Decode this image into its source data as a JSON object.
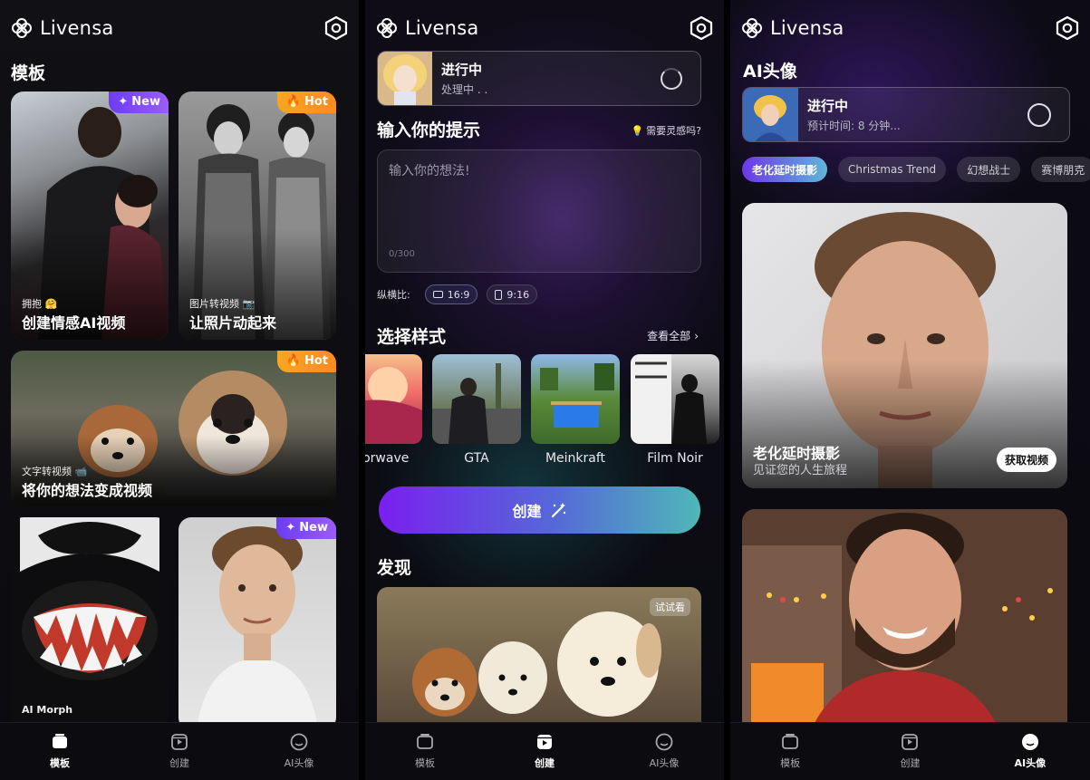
{
  "app": {
    "name": "Livensa"
  },
  "nav": {
    "templates": "模板",
    "create": "创建",
    "avatar": "AI头像"
  },
  "screen1": {
    "section_title": "模板",
    "cards": [
      {
        "badge": "New",
        "small": "拥抱 🤗",
        "title": "创建情感AI视频"
      },
      {
        "badge": "Hot",
        "small": "图片转视频 📷",
        "title": "让照片动起来"
      },
      {
        "badge": "Hot",
        "small": "文字转视频 📹",
        "title": "将你的想法变成视频"
      },
      {
        "badge": "",
        "small": "AI Morph",
        "title": ""
      },
      {
        "badge": "New",
        "small": "",
        "title": ""
      }
    ]
  },
  "screen2": {
    "progress": {
      "title": "进行中",
      "subtitle": "处理中 . ."
    },
    "prompt_title": "输入你的提示",
    "inspire": "需要灵感吗?",
    "prompt_placeholder": "输入你的想法!",
    "char_count": "0/300",
    "ratio_label": "纵横比:",
    "ratios": [
      "16:9",
      "9:16"
    ],
    "style_title": "选择样式",
    "view_all": "查看全部",
    "styles": [
      "aporwave",
      "GTA",
      "Meinkraft",
      "Film Noir"
    ],
    "create_button": "创建",
    "discover_title": "发现",
    "discover_tag": "试试看"
  },
  "screen3": {
    "section_title": "AI头像",
    "progress": {
      "title": "进行中",
      "subtitle": "预计时间: 8 分钟..."
    },
    "chips": [
      "老化延时摄影",
      "Christmas Trend",
      "幻想战士",
      "赛博朋克"
    ],
    "card1": {
      "title": "老化延时摄影",
      "subtitle": "见证您的人生旅程",
      "button": "获取视频"
    }
  },
  "colors": {
    "accent_purple": "#7a1ff0",
    "hot_orange": "#f6a623",
    "new_purple": "#8b4cff",
    "teal": "#4fb8b8"
  }
}
